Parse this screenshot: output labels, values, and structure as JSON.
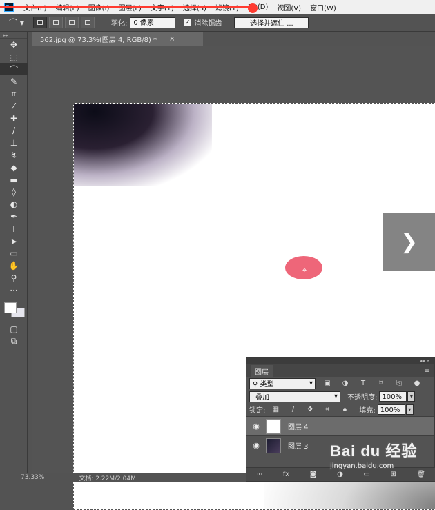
{
  "app": {
    "logo": "Ps"
  },
  "menu": [
    "文件(F)",
    "编辑(E)",
    "图像(I)",
    "图层(L)",
    "文字(Y)",
    "选择(S)",
    "滤镜(T)",
    "3D(D)",
    "视图(V)",
    "窗口(W)"
  ],
  "options": {
    "feather_label": "羽化:",
    "feather_value": "0 像素",
    "antialias_label": "消除锯齿",
    "antialias_checked": true,
    "refine_button": "选择并遮住 ..."
  },
  "document": {
    "tab_title": "562.jpg @ 73.3%(图层 4, RGB/8) *",
    "close": "×"
  },
  "tools": [
    "move-tool",
    "marquee-tool",
    "lasso-tool",
    "quick-select-tool",
    "crop-tool",
    "eyedropper-tool",
    "healing-tool",
    "brush-tool",
    "stamp-tool",
    "history-brush-tool",
    "eraser-tool",
    "gradient-tool",
    "blur-tool",
    "dodge-tool",
    "pen-tool",
    "type-tool",
    "path-select-tool",
    "shape-tool",
    "hand-tool",
    "zoom-tool",
    "more-tools"
  ],
  "active_tool": "lasso-tool",
  "colors": {
    "foreground": "#ffffff",
    "background": "#e6e6ee",
    "cursor_dot": "#ee6679",
    "progress": "#ff3b30"
  },
  "layers_panel": {
    "tab_label": "图层",
    "kind_filter": "类型",
    "blend_mode": "叠加",
    "opacity_label": "不透明度:",
    "opacity_value": "100%",
    "lock_label": "锁定:",
    "fill_label": "填充:",
    "fill_value": "100%",
    "layers": [
      {
        "name": "图层 4",
        "visible": true,
        "selected": true
      },
      {
        "name": "图层 3",
        "visible": true,
        "selected": false
      }
    ],
    "footer_fx": "fx"
  },
  "status": {
    "zoom": "73.33%",
    "doc": "文档: 2.22M/2.04M"
  },
  "watermark": {
    "logo": "Bai du 经验",
    "site": "jingyan.baidu.com"
  }
}
